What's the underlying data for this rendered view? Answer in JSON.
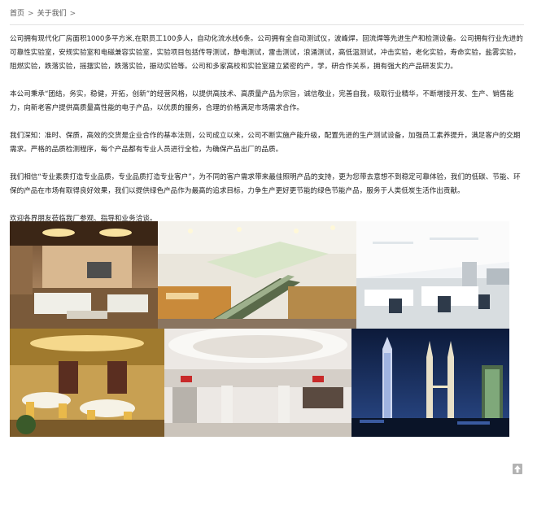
{
  "breadcrumb": {
    "home": "首页",
    "separator": ">",
    "current": "关于我们"
  },
  "paragraphs": [
    "公司拥有现代化厂房面积1000多平方米,在职员工100多人，自动化流水线6条。公司拥有全自动测试仪，波峰焊，回流焊等先进生产和检测设备。公司拥有行业先进的可靠性实验室，安规实验室和电磁兼容实验室，实验项目包括传导测试，静电测试，雷击测试，浪涌测试，高低温测试，冲击实验，老化实验，寿命实验，盐雾实验，阻燃实验，跌落实验，摇摆实验，跌落实验，振动实验等。公司和多家高校和实验室建立紧密的产，学，研合作关系，拥有强大的产品研发实力。",
    "本公司秉承“团结，务实，稳健，开拓，创新”的经营风格，以提供高技术、高质量产品为宗旨，诚信敬业，完善自我，吸取行业精华，不断增接开发、生产、销售能力，向新老客户提供高质量高性能的电子产品，以优质的服务，合理的价格满足市场需求合作。",
    "我们深知：准时、保质，高效的交货是企业合作的基本法则，公司成立以来，公司不断实施产能升级，配置先进的生产测试设备，加强员工素养提升，满足客户的交期需求。严格的品质检测程序，每个产品都有专业人员进行全检，为确保产品出厂的品质。",
    "我们相信“专业素质打造专业品质，专业品质打造专业客户”，为不同的客户需求带来最佳照明产品的支持，更为您带去意想不到稳定可靠体验，我们的低碳、节能、环保的产品在市场有取得良好效果，我们以提供绿色产品作为最高的追求目标，力争生产更好更节能的绿色节能产品，服务于人类低炭生活作出贡献。",
    "欢迎各界朋友莅临我厂参观、指导和业务洽谈。"
  ],
  "gallery": {
    "photos": [
      {
        "subject": "living-room"
      },
      {
        "subject": "shopping-mall-escalator"
      },
      {
        "subject": "open-office"
      },
      {
        "subject": "restaurant-dining-hall"
      },
      {
        "subject": "shopping-mall-atrium"
      },
      {
        "subject": "night-city-skyline"
      }
    ]
  },
  "back_to_top": {
    "icon": "arrow-up-icon"
  },
  "colors": {
    "text": "#222222",
    "rule": "#e2e2e2",
    "totop_bg": "#b3b3b3"
  }
}
